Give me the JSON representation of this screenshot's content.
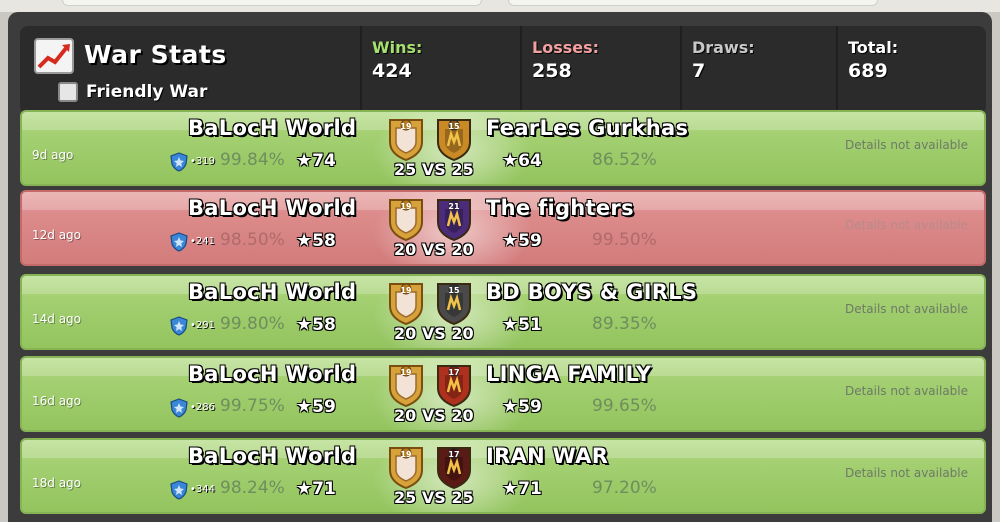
{
  "header": {
    "title": "War Stats",
    "friendly_war_label": "Friendly War",
    "friendly_war_checked": false,
    "stats": [
      {
        "label": "Wins:",
        "value": "424",
        "color": "#a5e070"
      },
      {
        "label": "Losses:",
        "value": "258",
        "color": "#f2a0a0"
      },
      {
        "label": "Draws:",
        "value": "7",
        "color": "#c8c8c8"
      },
      {
        "label": "Total:",
        "value": "689",
        "color": "#ffffff"
      }
    ]
  },
  "wars": [
    {
      "result": "win",
      "ago": "9d ago",
      "home_name": "BaLocH World",
      "home_badge_level": "19",
      "home_trophies": "319",
      "home_pct": "99.84%",
      "home_stars": "74",
      "opp_name": "FearLes Gurkhas",
      "opp_badge_level": "15",
      "opp_badge_color": "#c98a26",
      "opp_pct": "86.52%",
      "opp_stars": "64",
      "size_text": "25 VS 25",
      "details": "Details not available"
    },
    {
      "result": "loss",
      "ago": "12d ago",
      "home_name": "BaLocH World",
      "home_badge_level": "19",
      "home_trophies": "241",
      "home_pct": "98.50%",
      "home_stars": "58",
      "opp_name": "The fighters",
      "opp_badge_level": "21",
      "opp_badge_color": "#4b2b7a",
      "opp_pct": "99.50%",
      "opp_stars": "59",
      "size_text": "20 VS 20",
      "details": "Details not available"
    },
    {
      "result": "win",
      "ago": "14d ago",
      "home_name": "BaLocH World",
      "home_badge_level": "19",
      "home_trophies": "291",
      "home_pct": "99.80%",
      "home_stars": "58",
      "opp_name": "BD BOYS & GIRLS",
      "opp_badge_level": "15",
      "opp_badge_color": "#4a4a4a",
      "opp_pct": "89.35%",
      "opp_stars": "51",
      "size_text": "20 VS 20",
      "details": "Details not available"
    },
    {
      "result": "win",
      "ago": "16d ago",
      "home_name": "BaLocH World",
      "home_badge_level": "19",
      "home_trophies": "286",
      "home_pct": "99.75%",
      "home_stars": "59",
      "opp_name": "LINGA FAMILY",
      "opp_badge_level": "17",
      "opp_badge_color": "#b0301e",
      "opp_pct": "99.65%",
      "opp_stars": "59",
      "size_text": "20 VS 20",
      "details": "Details not available"
    },
    {
      "result": "win",
      "ago": "18d ago",
      "home_name": "BaLocH World",
      "home_badge_level": "19",
      "home_trophies": "344",
      "home_pct": "98.24%",
      "home_stars": "71",
      "opp_name": "IRAN WAR",
      "opp_badge_level": "17",
      "opp_badge_color": "#5a1a16",
      "opp_pct": "97.20%",
      "opp_stars": "71",
      "size_text": "25 VS 25",
      "details": "Details not available"
    }
  ],
  "icons": {
    "header_icon": "chart-up-icon",
    "star_icon": "star-icon",
    "trophy_icon": "shield-trophy-icon",
    "badge_icon": "clan-badge-icon"
  },
  "colors": {
    "win_row": "#a4d072",
    "loss_row": "#dc8b8b",
    "header_bg": "#2b2b2b"
  }
}
